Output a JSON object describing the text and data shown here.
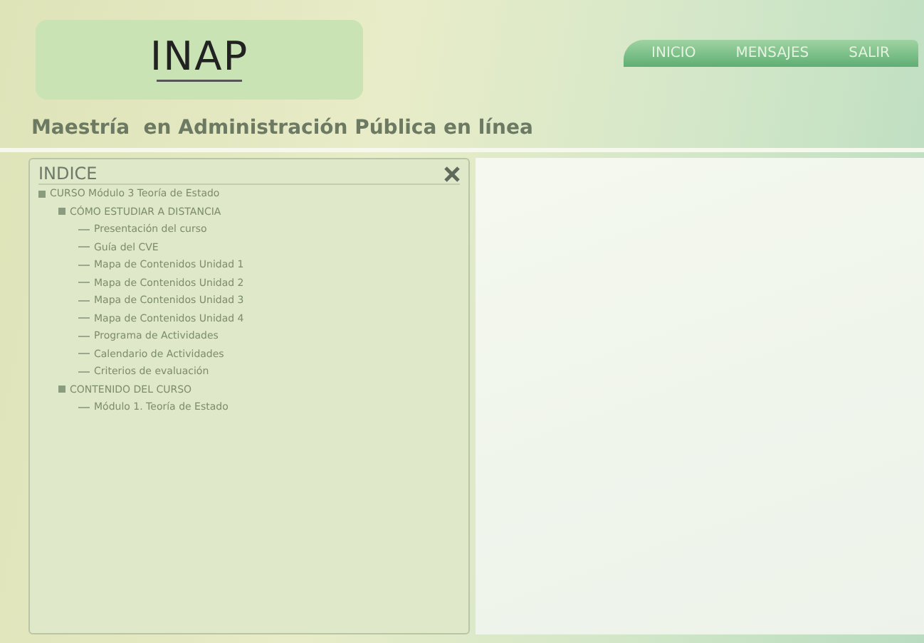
{
  "logo": {
    "text": "INAP"
  },
  "nav": [
    "INICIO",
    "MENSAJES",
    "SALIR"
  ],
  "title": "Maestría  en Administración Pública en línea",
  "index_panel": {
    "title": "INDICE",
    "tree": [
      {
        "label": "CURSO Módulo 3 Teoría de Estado",
        "children": [
          {
            "label": "CÓMO ESTUDIAR A DISTANCIA",
            "children": [
              {
                "label": "Presentación del curso"
              },
              {
                "label": "Guía del CVE"
              },
              {
                "label": "Mapa de Contenidos Unidad 1"
              },
              {
                "label": "Mapa de Contenidos Unidad 2"
              },
              {
                "label": "Mapa de Contenidos Unidad 3"
              },
              {
                "label": "Mapa de Contenidos Unidad 4"
              },
              {
                "label": "Programa de Actividades"
              },
              {
                "label": "Calendario de Actividades"
              },
              {
                "label": "Criterios de evaluación"
              }
            ]
          },
          {
            "label": "CONTENIDO DEL CURSO",
            "children": [
              {
                "label": "Módulo 1. Teoría de Estado"
              }
            ]
          }
        ]
      }
    ]
  }
}
